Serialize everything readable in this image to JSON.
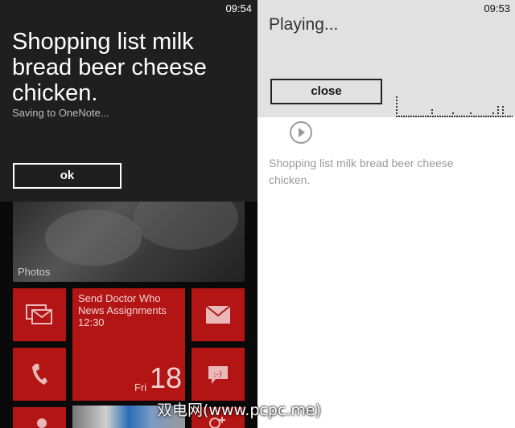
{
  "left": {
    "time": "09:54",
    "dictated_text": "Shopping list milk bread beer cheese chicken.",
    "status": "Saving to OneNote...",
    "ok_label": "ok",
    "photos_label": "Photos",
    "calendar": {
      "event": "Send Doctor Who News Assignments",
      "event_time": "12:30",
      "day": "Fri",
      "date": "18"
    },
    "icons": [
      "messaging-icon",
      "mail-icon",
      "phone-icon",
      "chat-icon",
      "people-icon"
    ]
  },
  "right": {
    "time": "09:53",
    "playing_label": "Playing...",
    "close_label": "close",
    "note_text": "Shopping list milk bread beer cheese chicken.",
    "play_icon": "play-icon"
  },
  "watermark": "双电网(www.pcpc.me)",
  "colors": {
    "tile_red": "#b31515",
    "dialog_bg": "#1f1f1f",
    "header_gray": "#e1e1e1"
  }
}
